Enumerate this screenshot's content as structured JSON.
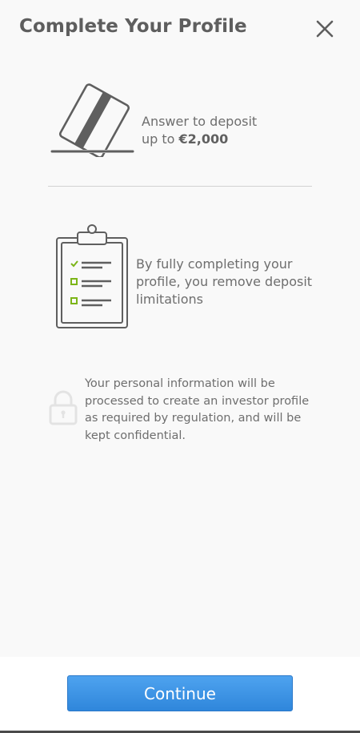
{
  "header": {
    "title": "Complete Your Profile",
    "close_icon": "close-icon"
  },
  "deposit": {
    "icon": "credit-card-icon",
    "line1": "Answer to deposit",
    "prefix": "up to ",
    "amount": "€2,000"
  },
  "limitations": {
    "icon": "clipboard-checklist-icon",
    "text": "By fully completing your profile, you remove deposit limitations"
  },
  "privacy": {
    "icon": "lock-icon",
    "text": "Your personal information will be processed to create an investor profile as required by regulation, and will be kept confidential."
  },
  "footer": {
    "continue_label": "Continue"
  },
  "colors": {
    "background": "#f9f9f9",
    "title": "#5e5e5e",
    "body_text": "#6e6e6e",
    "icon_stroke": "#5f5f5f",
    "check_green": "#7cb518",
    "button": "#3c94e4"
  }
}
